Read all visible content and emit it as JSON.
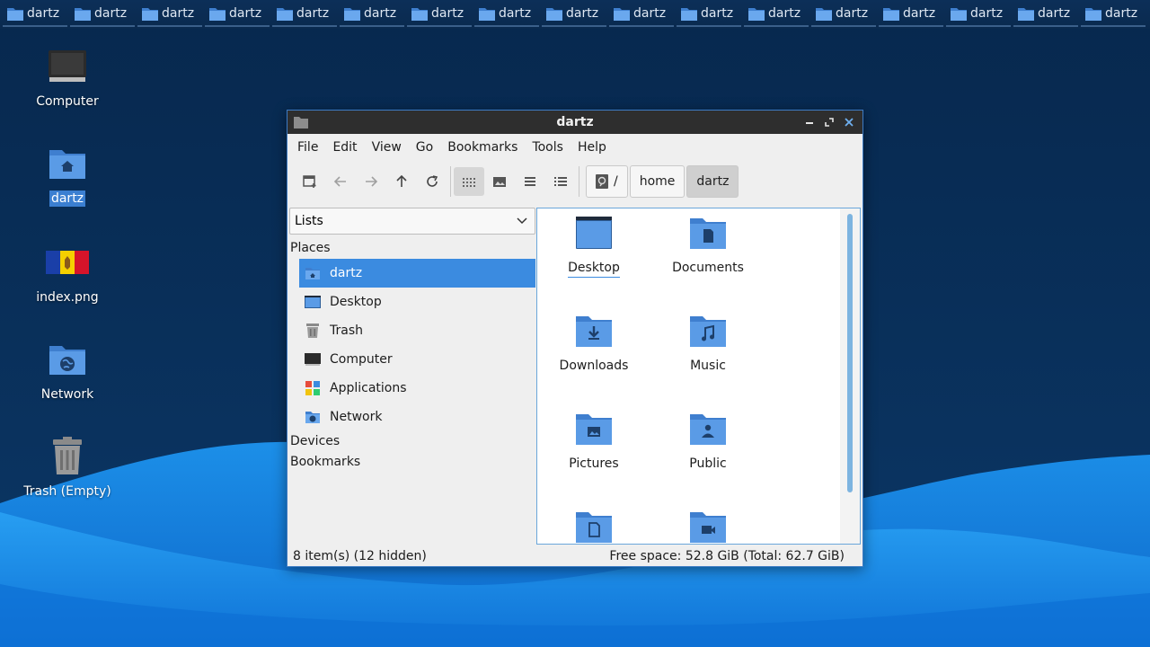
{
  "taskbar": {
    "items": [
      {
        "label": "dartz"
      },
      {
        "label": "dartz"
      },
      {
        "label": "dartz"
      },
      {
        "label": "dartz"
      },
      {
        "label": "dartz"
      },
      {
        "label": "dartz"
      },
      {
        "label": "dartz"
      },
      {
        "label": "dartz"
      },
      {
        "label": "dartz"
      },
      {
        "label": "dartz"
      },
      {
        "label": "dartz"
      },
      {
        "label": "dartz"
      },
      {
        "label": "dartz"
      },
      {
        "label": "dartz"
      },
      {
        "label": "dartz"
      },
      {
        "label": "dartz"
      },
      {
        "label": "dartz"
      }
    ],
    "icon": "folder-icon"
  },
  "desktop": {
    "icons": [
      {
        "label": "Computer",
        "icon": "computer-icon"
      },
      {
        "label": "dartz",
        "icon": "home-folder-icon",
        "selected": true
      },
      {
        "label": "index.png",
        "icon": "image-file-icon"
      },
      {
        "label": "Network",
        "icon": "network-icon"
      },
      {
        "label": "Trash (Empty)",
        "icon": "trash-icon"
      }
    ]
  },
  "window": {
    "title": "dartz",
    "controls": {
      "minimize": "minimize-icon",
      "maximize": "maximize-icon",
      "close": "close-icon"
    },
    "menu": [
      "File",
      "Edit",
      "View",
      "Go",
      "Bookmarks",
      "Tools",
      "Help"
    ],
    "toolbar": {
      "buttons": [
        "new-tab-icon",
        "back-icon",
        "forward-icon",
        "up-icon",
        "reload-icon",
        "icon-view-icon",
        "thumbnail-view-icon",
        "compact-view-icon",
        "detailed-list-icon"
      ]
    },
    "breadcrumb": {
      "root": "/",
      "items": [
        "home",
        "dartz"
      ]
    },
    "sidepane": {
      "mode": "Lists",
      "places_header": "Places",
      "places": [
        {
          "label": "dartz",
          "icon": "home-folder-icon",
          "selected": true
        },
        {
          "label": "Desktop",
          "icon": "desktop-icon"
        },
        {
          "label": "Trash",
          "icon": "trash-icon"
        },
        {
          "label": "Computer",
          "icon": "computer-icon"
        },
        {
          "label": "Applications",
          "icon": "applications-icon"
        },
        {
          "label": "Network",
          "icon": "network-icon"
        }
      ],
      "devices_header": "Devices",
      "bookmarks_header": "Bookmarks"
    },
    "files": [
      {
        "name": "Desktop",
        "icon": "desktop-folder-icon"
      },
      {
        "name": "Documents",
        "icon": "documents-folder-icon"
      },
      {
        "name": "Downloads",
        "icon": "downloads-folder-icon"
      },
      {
        "name": "Music",
        "icon": "music-folder-icon"
      },
      {
        "name": "Pictures",
        "icon": "pictures-folder-icon"
      },
      {
        "name": "Public",
        "icon": "public-folder-icon"
      },
      {
        "name": "",
        "icon": "templates-folder-icon"
      },
      {
        "name": "",
        "icon": "videos-folder-icon"
      }
    ],
    "status": {
      "left": "8 item(s) (12 hidden)",
      "right": "Free space: 52.8 GiB (Total: 62.7 GiB)"
    }
  }
}
